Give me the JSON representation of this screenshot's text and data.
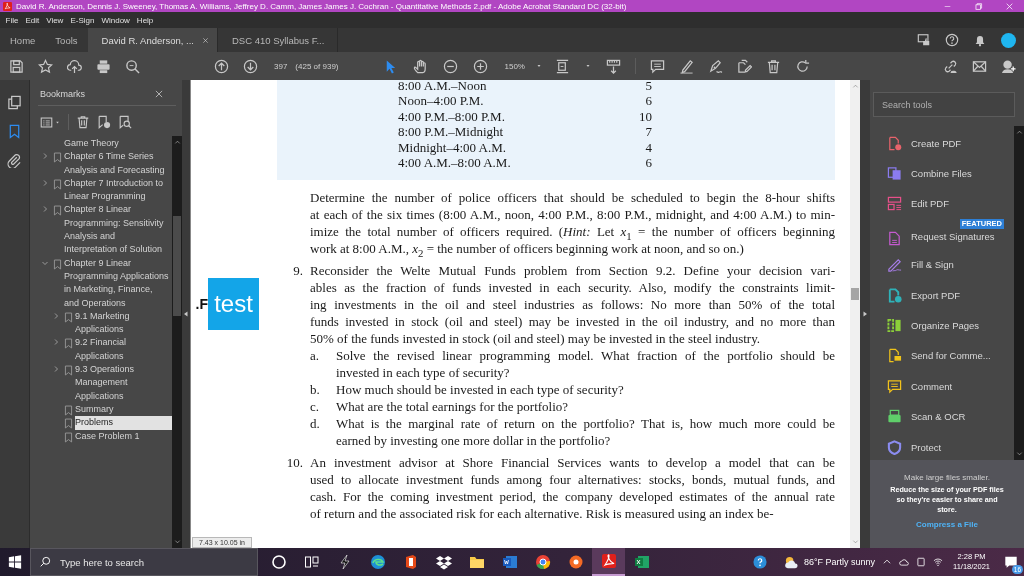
{
  "window": {
    "title": "David R. Anderson, Dennis J. Sweeney, Thomas A. Williams, Jeffrey D. Camm, James James J. Cochran - Quantitative Methods  2.pdf - Adobe Acrobat Standard DC (32-bit)"
  },
  "menu": [
    "File",
    "Edit",
    "View",
    "E-Sign",
    "Window",
    "Help"
  ],
  "tabs": [
    {
      "label": "Home",
      "kind": "nav",
      "selected": false
    },
    {
      "label": "Tools",
      "kind": "nav",
      "selected": false
    },
    {
      "label": "David R. Anderson, ...",
      "kind": "doc",
      "selected": true
    },
    {
      "label": "DSC 410 Syllabus F...",
      "kind": "doc",
      "selected": false
    }
  ],
  "toolbar": {
    "page": "397",
    "page_count": "(425 of 939)",
    "zoom": "150%",
    "tools": [
      {
        "kind": "select",
        "selected": true
      },
      {
        "kind": "hand",
        "selected": false
      }
    ]
  },
  "side_icons": [
    {
      "kind": "pages",
      "selected": false
    },
    {
      "kind": "bookmarks",
      "selected": true
    },
    {
      "kind": "attachments",
      "selected": false
    }
  ],
  "bookmarks": {
    "title": "Bookmarks",
    "items": [
      {
        "label": "Game Theory",
        "kind": "fragment",
        "selected": false
      },
      {
        "label": "Chapter 6 Time Series Analysis and Forecasting",
        "kind": "folder",
        "expanded": false,
        "selected": false
      },
      {
        "label": "Chapter 7 Introduction to Linear Programming",
        "kind": "folder",
        "expanded": false,
        "selected": false
      },
      {
        "label": "Chapter 8 Linear Programming: Sensitivity Analysis and Interpretation of Solution",
        "kind": "folder",
        "expanded": false,
        "selected": false
      },
      {
        "label": "Chapter 9 Linear Programming Applications in Marketing, Finance, and Operations",
        "kind": "folder",
        "expanded": true,
        "selected": false,
        "children": [
          {
            "label": "9.1 Marketing Applications",
            "kind": "folder",
            "expanded": false,
            "selected": false
          },
          {
            "label": "9.2 Financial Applications",
            "kind": "folder",
            "expanded": false,
            "selected": false
          },
          {
            "label": "9.3 Operations Management Applications",
            "kind": "folder",
            "expanded": false,
            "selected": false
          },
          {
            "label": "Summary",
            "kind": "leaf",
            "selected": false
          },
          {
            "label": "Problems",
            "kind": "leaf",
            "selected": true
          },
          {
            "label": "Case Problem 1",
            "kind": "leaf",
            "selected": false
          }
        ]
      }
    ]
  },
  "document": {
    "table_rows": [
      {
        "label": "8:00 A.M.–Noon",
        "value": "5"
      },
      {
        "label": "Noon–4:00 P.M.",
        "value": "6"
      },
      {
        "label": "4:00 P.M.–8:00 P.M.",
        "value": "10"
      },
      {
        "label": "8:00 P.M.–Midnight",
        "value": "7"
      },
      {
        "label": "Midnight–4:00 A.M.",
        "value": "4"
      },
      {
        "label": "4:00 A.M.–8:00 A.M.",
        "value": "6"
      }
    ],
    "blocks": [
      {
        "kind": "text",
        "lines": [
          "Determine the number of police officers that should be scheduled to begin the 8-hour shifts",
          "at each of the six times (8:00 A.M., noon, 4:00 P.M., 8:00 P.M., midnight, and 4:00 A.M.) to min-",
          "imize the total number of officers required. (*Hint:* Let *x*$_{1}$ = the number of officers beginning",
          "work at 8:00 A.M., *x*$_{2}$ = the number of officers beginning work at noon, and so on.)"
        ]
      },
      {
        "kind": "problem",
        "number": "9.",
        "lines": [
          "Reconsider the Welte Mutual Funds problem from Section 9.2. Define your decision vari-",
          "ables as the fraction of funds invested in each security. Also, modify the constraints limit-",
          "ing investments in the oil and steel industries as follows: No more than 50% of the total",
          "funds invested in stock (oil and steel) may be invested in the oil industry, and no more than",
          "50% of the funds invested in stock (oil and steel) may be invested in the steel industry."
        ],
        "parts": [
          {
            "letter": "a.",
            "lines": [
              "Solve the revised linear programming model. What fraction of the portfolio should be",
              "invested in each type of security?"
            ]
          },
          {
            "letter": "b.",
            "lines": [
              "How much should be invested in each type of security?"
            ]
          },
          {
            "letter": "c.",
            "lines": [
              "What are the total earnings for the portfolio?"
            ]
          },
          {
            "letter": "d.",
            "lines": [
              "What is the marginal rate of return on the portfolio? That is, how much more could be",
              "earned by investing one more dollar in the portfolio?"
            ]
          }
        ]
      },
      {
        "kind": "problem",
        "number": "10.",
        "lines": [
          "An investment advisor at Shore Financial Services wants to develop a model that can be",
          "used to allocate investment funds among four alternatives: stocks, bonds, mutual funds, and",
          "cash. For the coming investment period, the company developed estimates of the annual rate",
          "of return and the associated risk for each alternative. Risk is measured using an index be-"
        ]
      }
    ],
    "overlay": {
      "prefix": ".F",
      "label": "test"
    },
    "page_size": "7.43 x 10.05 in"
  },
  "tools_panel": {
    "search": {
      "placeholder": "Search tools"
    },
    "tools": [
      {
        "label": "Create PDF",
        "kind": "docplus",
        "color": "#e8636b"
      },
      {
        "label": "Combine Files",
        "kind": "files",
        "color": "#8b7cf0"
      },
      {
        "label": "Edit PDF",
        "kind": "layout",
        "color": "#e8508a"
      },
      {
        "label": "Request Signatures",
        "kind": "doc",
        "color": "#c55ad0",
        "badge": "FEATURED"
      },
      {
        "label": "Fill & Sign",
        "kind": "pen",
        "color": "#a77de8"
      },
      {
        "label": "Export PDF",
        "kind": "docarrow",
        "color": "#2fb2b8"
      },
      {
        "label": "Organize Pages",
        "kind": "pages",
        "color": "#8ccf3a"
      },
      {
        "label": "Send for Comme...",
        "kind": "doccomment",
        "color": "#f0c419"
      },
      {
        "label": "Comment",
        "kind": "comment",
        "color": "#f2c21b"
      },
      {
        "label": "Scan & OCR",
        "kind": "scanner",
        "color": "#5fcf6a"
      },
      {
        "label": "Protect",
        "kind": "shield",
        "color": "#8b8cf0"
      }
    ],
    "promo": {
      "title": "Make large files smaller.",
      "text": "Reduce the size of your PDF files so they're easier to share and store.",
      "link": "Compress a File"
    }
  },
  "taskbar": {
    "search": {
      "placeholder": "Type here to search"
    },
    "apps": [
      {
        "kind": "cortana",
        "active": false
      },
      {
        "kind": "taskview",
        "active": false
      },
      {
        "kind": "bolt",
        "active": false
      },
      {
        "kind": "edge",
        "active": false
      },
      {
        "kind": "office",
        "active": false
      },
      {
        "kind": "dropbox",
        "active": false
      },
      {
        "kind": "folder",
        "active": false
      },
      {
        "kind": "word",
        "active": false
      },
      {
        "kind": "chrome",
        "active": false
      },
      {
        "kind": "orange",
        "active": false
      },
      {
        "kind": "acrobat",
        "active": true
      },
      {
        "kind": "excel",
        "active": false
      }
    ],
    "weather": "86°F Partly sunny",
    "time": "2:28 PM",
    "date": "11/18/2021",
    "notifications": "16"
  }
}
